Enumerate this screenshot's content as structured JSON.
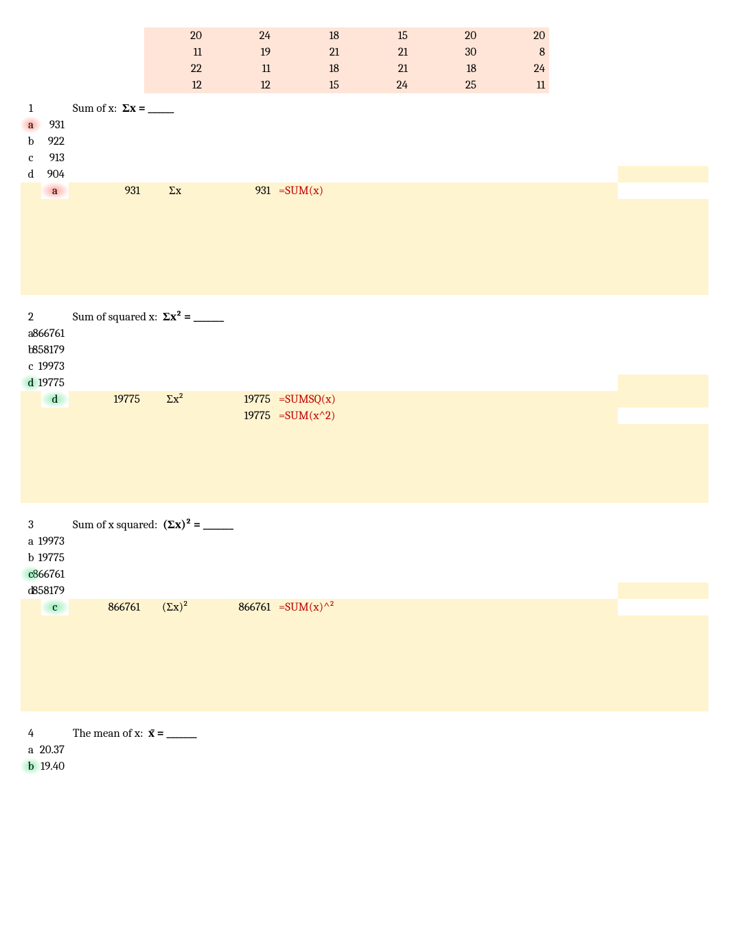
{
  "data_rows": [
    [
      "20",
      "24",
      "18",
      "15",
      "20",
      "20"
    ],
    [
      "11",
      "19",
      "21",
      "21",
      "30",
      "8"
    ],
    [
      "22",
      "11",
      "18",
      "21",
      "18",
      "24"
    ],
    [
      "12",
      "12",
      "15",
      "24",
      "25",
      "11"
    ]
  ],
  "q1": {
    "num": "1",
    "prompt_text": "Sum of x:",
    "prompt_sym": "Σx = ______",
    "opts": [
      {
        "letter": "a",
        "val": "931",
        "hot": "red"
      },
      {
        "letter": "b",
        "val": "922"
      },
      {
        "letter": "c",
        "val": "913"
      },
      {
        "letter": "d",
        "val": "904"
      }
    ],
    "ans": {
      "letter": "a",
      "val": "931",
      "sym": "Σx",
      "comp": "931",
      "formulas": [
        "=SUM(x)"
      ]
    }
  },
  "q2": {
    "num": "2",
    "prompt_text": "Sum of squared x:",
    "prompt_sym": "Σx² = _______",
    "opts": [
      {
        "letter": "a",
        "val": "866761"
      },
      {
        "letter": "b",
        "val": "858179"
      },
      {
        "letter": "c",
        "val": "19973"
      },
      {
        "letter": "d",
        "val": "19775",
        "hot": "green"
      }
    ],
    "ans": {
      "letter": "d",
      "val": "19775",
      "sym": "Σx²",
      "comp": "19775",
      "formulas": [
        "=SUMSQ(x)",
        "=SUM(x^2)"
      ],
      "comp2": "19775"
    }
  },
  "q3": {
    "num": "3",
    "prompt_text": "Sum of x squared:",
    "prompt_sym": "(Σx)² = _______",
    "opts": [
      {
        "letter": "a",
        "val": "19973"
      },
      {
        "letter": "b",
        "val": "19775"
      },
      {
        "letter": "c",
        "val": "866761",
        "hot": "green"
      },
      {
        "letter": "d",
        "val": "858179"
      }
    ],
    "ans": {
      "letter": "c",
      "val": "866761",
      "sym": "(Σx)²",
      "comp": "866761",
      "formulas": [
        "=SUM(x)^²"
      ]
    }
  },
  "q4": {
    "num": "4",
    "prompt_text": "The mean of x:",
    "prompt_sym": "x̄ = _______",
    "opts": [
      {
        "letter": "a",
        "val": "20.37"
      },
      {
        "letter": "b",
        "val": "19.40",
        "hot": "green"
      }
    ]
  }
}
